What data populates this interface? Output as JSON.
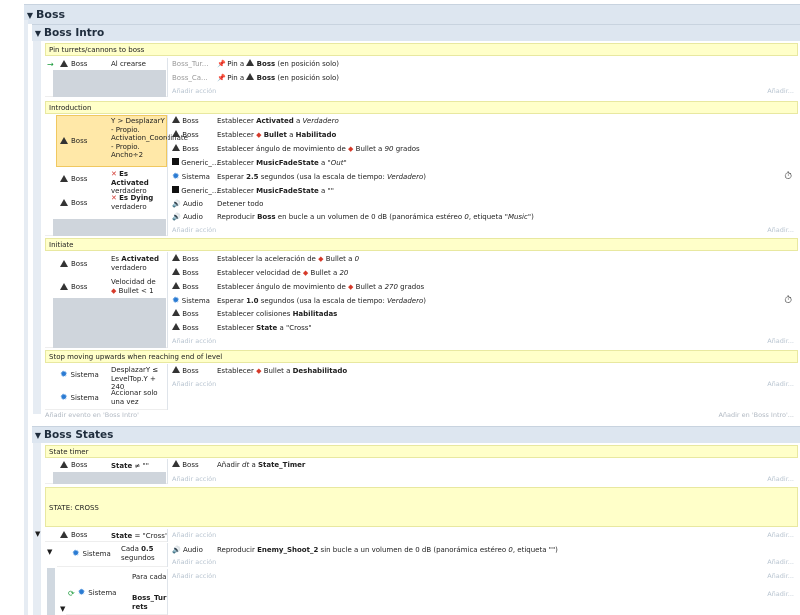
{
  "groups": {
    "boss": "Boss",
    "boss_intro": "Boss Intro",
    "boss_states": "Boss States"
  },
  "comments": {
    "pin": "Pin turrets/cannons to boss",
    "intro": "Introduction",
    "initiate": "Initiate",
    "stop": "Stop moving upwards when reaching end of level",
    "state_timer": "State timer",
    "state_cross": "STATE: CROSS"
  },
  "labels": {
    "add_action": "Añadir acción",
    "add_right": "Añadir...",
    "add_event": "Añadir evento en 'Boss Intro'",
    "add_in": "Añadir en 'Boss Intro'..."
  },
  "pin_event": {
    "obj": "Boss",
    "cond": "Al crearse",
    "actions": [
      {
        "obj": "Boss_Tur...",
        "pre": "Pin a",
        "bold": "Boss",
        "post": "(en posición solo)"
      },
      {
        "obj": "Boss_Ca...",
        "pre": "Pin a",
        "bold": "Boss",
        "post": "(en posición solo)"
      }
    ]
  },
  "intro_event": {
    "c1_obj": "Boss",
    "c1_text": "Y > DesplazarY - Propio. Activation_Coordinate - Propio. Ancho÷2",
    "c2_obj": "Boss",
    "c2_bold": "Es Activated",
    "c2_rest": "verdadero",
    "c3_obj": "Boss",
    "c3_bold": "Es Dying",
    "c3_rest": "verdadero",
    "actions": [
      {
        "obj": "Boss",
        "t1": "Establecer ",
        "b": "Activated",
        "t2": " a ",
        "i": "Verdadero"
      },
      {
        "obj": "Boss",
        "t1": "Establecer ",
        "b": "Bullet",
        "t2": " a ",
        "b2": "Habilitado"
      },
      {
        "obj": "Boss",
        "t1": "Establecer ángulo de movimiento de ",
        "b": "Bullet",
        "t2": " a ",
        "i": "90",
        "t3": " grados"
      },
      {
        "obj": "Generic_...",
        "t1": "Establecer ",
        "b": "MusicFadeState",
        "t2": " a ",
        "i": "\"Out\""
      },
      {
        "obj": "Sistema",
        "t1": "Esperar ",
        "b": "2.5",
        "t2": " segundos (usa la escala de tiempo: ",
        "i": "Verdadero",
        "t3": ")"
      },
      {
        "obj": "Generic_...",
        "t1": "Establecer ",
        "b": "MusicFadeState",
        "t2": " a \"\""
      },
      {
        "obj": "Audio",
        "t1": "Detener todo"
      },
      {
        "obj": "Audio",
        "t1": "Reproducir ",
        "b": "Boss",
        "t2": " en bucle a un volumen de 0 dB (panorámica estéreo ",
        "i": "0",
        "t3": ", etiqueta ",
        "i2": "\"Music\"",
        "t4": ")"
      }
    ]
  },
  "initiate_event": {
    "c1_obj": "Boss",
    "c1_a": "Es ",
    "c1_b": "Activated",
    "c1_c": "verdadero",
    "c2_obj": "Boss",
    "c2_a": "Velocidad de",
    "c2_b": "Bullet < 1",
    "actions": [
      {
        "obj": "Boss",
        "t1": "Establecer la aceleración de ",
        "b": "Bullet",
        "t2": " a ",
        "i": "0"
      },
      {
        "obj": "Boss",
        "t1": "Establecer velocidad de ",
        "b": "Bullet",
        "t2": " a ",
        "i": "20"
      },
      {
        "obj": "Boss",
        "t1": "Establecer ángulo de movimiento de ",
        "b": "Bullet",
        "t2": " a ",
        "i": "270",
        "t3": " grados"
      },
      {
        "obj": "Sistema",
        "t1": "Esperar ",
        "b": "1.0",
        "t2": " segundos (usa la escala de tiempo: ",
        "i": "Verdadero",
        "t3": ")"
      },
      {
        "obj": "Boss",
        "t1": "Establecer colisiones ",
        "b": "Habilitadas"
      },
      {
        "obj": "Boss",
        "t1": "Establecer ",
        "b": "State",
        "t2": " a \"Cross\""
      }
    ]
  },
  "stop_event": {
    "c1_obj": "Sistema",
    "c1_text": "DesplazarY ≤ LevelTop.Y + 240",
    "c2_obj": "Sistema",
    "c2_text": "Accionar solo una vez",
    "action": {
      "obj": "Boss",
      "t1": "Establecer ",
      "b": "Bullet",
      "t2": " a ",
      "b2": "Deshabilitado"
    }
  },
  "timer_event": {
    "obj": "Boss",
    "cb": "State",
    "cr": " ≠ \"\"",
    "a_obj": "Boss",
    "a1": "Añadir ",
    "ai": "dt",
    "a2": " a ",
    "ab": "State_Timer"
  },
  "cross_event": {
    "obj": "Boss",
    "cb": "State",
    "cr": " = \"Cross\""
  },
  "shoot_event": {
    "obj": "Sistema",
    "c1": "Cada ",
    "cb": "0.5",
    "c2": "segundos",
    "a_obj": "Audio",
    "a1": "Reproducir ",
    "ab": "Enemy_Shoot_2",
    "a2": " sin bucle a un volumen de 0 dB (panorámica estéreo ",
    "ai": "0",
    "a3": ", etiqueta \"\")"
  },
  "foreach_event": {
    "obj": "Sistema",
    "c1": "Para cada",
    "cb1": "Boss_Tur",
    "cb2": "rets"
  }
}
